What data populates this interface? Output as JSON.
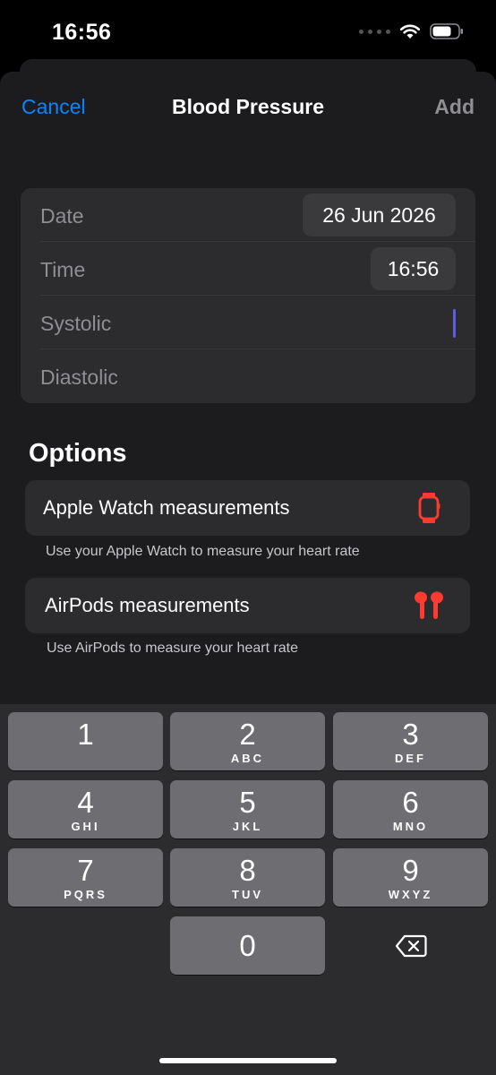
{
  "status_bar": {
    "time": "16:56",
    "wifi_icon": "wifi-icon",
    "battery_icon": "battery-icon"
  },
  "nav": {
    "cancel": "Cancel",
    "title": "Blood Pressure",
    "add": "Add"
  },
  "form": {
    "date_label": "Date",
    "date_value": "26 Jun 2026",
    "time_label": "Time",
    "time_value": "16:56",
    "systolic_label": "Systolic",
    "diastolic_label": "Diastolic"
  },
  "options": {
    "title": "Options",
    "items": [
      {
        "label": "Apple Watch measurements",
        "note": "Use your Apple Watch to measure your heart rate",
        "icon": "apple-watch-icon"
      },
      {
        "label": "AirPods measurements",
        "note": "Use AirPods to measure your heart rate",
        "icon": "airpods-icon"
      }
    ]
  },
  "keypad": {
    "keys": [
      {
        "num": "1",
        "letters": ""
      },
      {
        "num": "2",
        "letters": "ABC"
      },
      {
        "num": "3",
        "letters": "DEF"
      },
      {
        "num": "4",
        "letters": "GHI"
      },
      {
        "num": "5",
        "letters": "JKL"
      },
      {
        "num": "6",
        "letters": "MNO"
      },
      {
        "num": "7",
        "letters": "PQRS"
      },
      {
        "num": "8",
        "letters": "TUV"
      },
      {
        "num": "9",
        "letters": "WXYZ"
      },
      {
        "num": "0",
        "letters": ""
      }
    ],
    "backspace_icon": "backspace-icon"
  },
  "colors": {
    "accent": "#0a84ff",
    "icon_red": "#ff3b30",
    "cursor": "#5e5ce6"
  }
}
